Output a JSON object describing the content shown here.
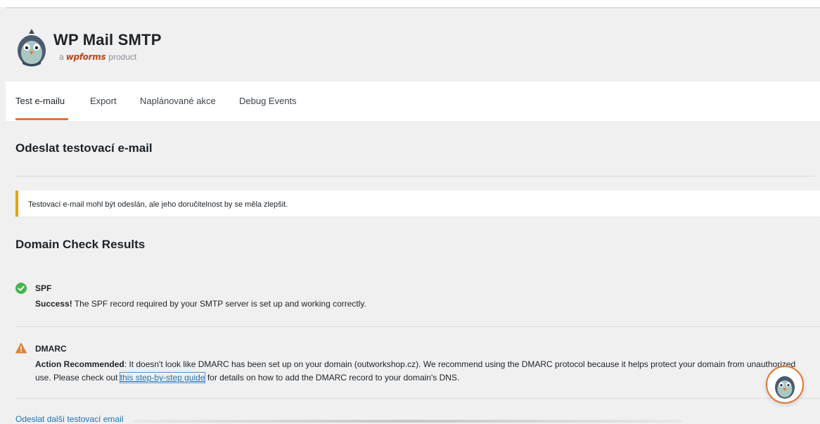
{
  "brand": {
    "title": "WP Mail SMTP",
    "sub_prefix": "a",
    "sub_brand": "wpforms",
    "sub_suffix": "product"
  },
  "tabs": [
    {
      "label": "Test e-mailu",
      "active": true
    },
    {
      "label": "Export",
      "active": false
    },
    {
      "label": "Naplánované akce",
      "active": false
    },
    {
      "label": "Debug Events",
      "active": false
    }
  ],
  "section_title": "Odeslat testovací e-mail",
  "notice": {
    "text": "Testovací e-mail mohl být odeslán, ale jeho doručitelnost by se měla zlepšit."
  },
  "domain_check": {
    "title": "Domain Check Results",
    "items": [
      {
        "name": "SPF",
        "status": "success",
        "status_label": "Success!",
        "message": " The SPF record required by your SMTP server is set up and working correctly."
      },
      {
        "name": "DMARC",
        "status": "warning",
        "status_label": "Action Recommended",
        "message_before_link": ": It doesn't look like DMARC has been set up on your domain (outworkshop.cz). We recommend using the DMARC protocol because it helps protect your domain from unauthorized use. Please check out ",
        "link_text": "this step-by-step guide",
        "message_after_link": " for details on how to add the DMARC record to your domain's DNS."
      }
    ]
  },
  "send_again_label": "Odeslat další testovací email",
  "colors": {
    "accent": "#e27730",
    "success": "#46b450",
    "warning": "#dd823b",
    "link": "#2271b1",
    "notice_border": "#dba617"
  },
  "icons": {
    "logo": "pigeon-logo-icon",
    "success": "check-circle-icon",
    "warning": "warning-triangle-icon",
    "helper": "pigeon-helper-icon"
  }
}
